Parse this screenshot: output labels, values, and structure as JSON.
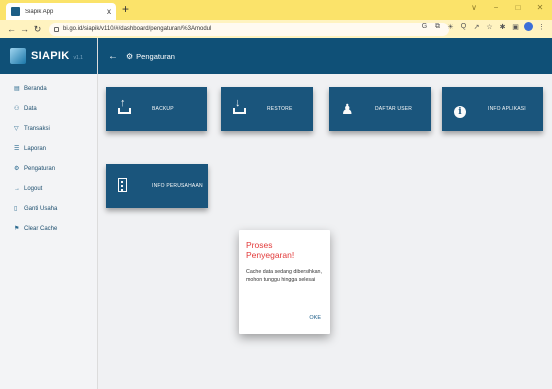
{
  "browser": {
    "tab_title": "Siapik App",
    "tab_close": "x",
    "new_tab": "+",
    "url": "bi.go.id/siapik/v110/#/dashboard/pengaturan/%3Amodul",
    "window_controls": [
      "∨",
      "−",
      "□",
      "✕"
    ],
    "extensions": [
      "G",
      "⧉",
      "☀",
      "Q",
      "↗",
      "☆",
      "✱",
      "▣"
    ]
  },
  "app": {
    "brand": "SIAPIK",
    "brand_sub": "v1.1"
  },
  "sidebar": {
    "items": [
      {
        "label": "Beranda",
        "icon": "calendar-icon",
        "glyph": "▤"
      },
      {
        "label": "Data",
        "icon": "group-icon",
        "glyph": "⚇"
      },
      {
        "label": "Transaksi",
        "icon": "filter-icon",
        "glyph": "▽"
      },
      {
        "label": "Laporan",
        "icon": "list-icon",
        "glyph": "☰"
      },
      {
        "label": "Pengaturan",
        "icon": "gear-icon",
        "glyph": "⚙"
      },
      {
        "label": "Logout",
        "icon": "logout-icon",
        "glyph": "→"
      },
      {
        "label": "Ganti Usaha",
        "icon": "document-icon",
        "glyph": "▯"
      },
      {
        "label": "Clear Cache",
        "icon": "pin-icon",
        "glyph": "⚑"
      }
    ]
  },
  "header": {
    "back": "←",
    "gear": "⚙",
    "title": "Pengaturan"
  },
  "tiles": [
    {
      "label": "BACKUP",
      "icon": "upload-icon"
    },
    {
      "label": "RESTORE",
      "icon": "download-icon"
    },
    {
      "label": "DAFTAR USER",
      "icon": "users-icon"
    },
    {
      "label": "INFO APLIKASI",
      "icon": "info-icon"
    },
    {
      "label": "INFO PERUSAHAAN",
      "icon": "building-icon"
    }
  ],
  "dialog": {
    "title": "Proses Penyegaran!",
    "message": "Cache data sedang dibersihkan, mohon tunggu hingga selesai",
    "ok_label": "OKE"
  }
}
